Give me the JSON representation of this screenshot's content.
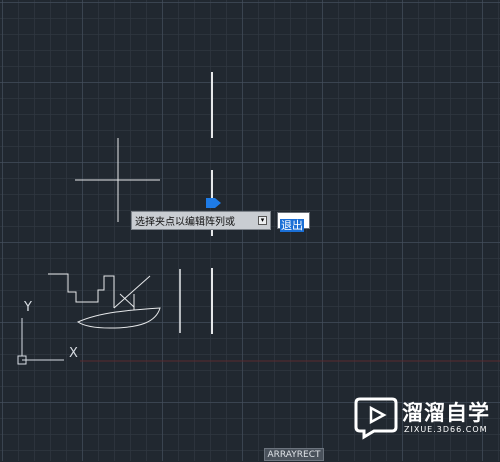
{
  "tooltip": {
    "text": "选择夹点以编辑阵列或",
    "dropdown_icon": "down-arrow-icon"
  },
  "input": {
    "value": "退出"
  },
  "command": {
    "name": "ARRAYRECT"
  },
  "ucs": {
    "x_label": "X",
    "y_label": "Y"
  },
  "watermark": {
    "title": "溜溜自学",
    "url": "ZIXUE.3D66.COM"
  },
  "colors": {
    "canvas": "#212830",
    "geometry": "#e6e8ea",
    "grip": "#1e7be6",
    "highlight": "#1a6fd6"
  }
}
